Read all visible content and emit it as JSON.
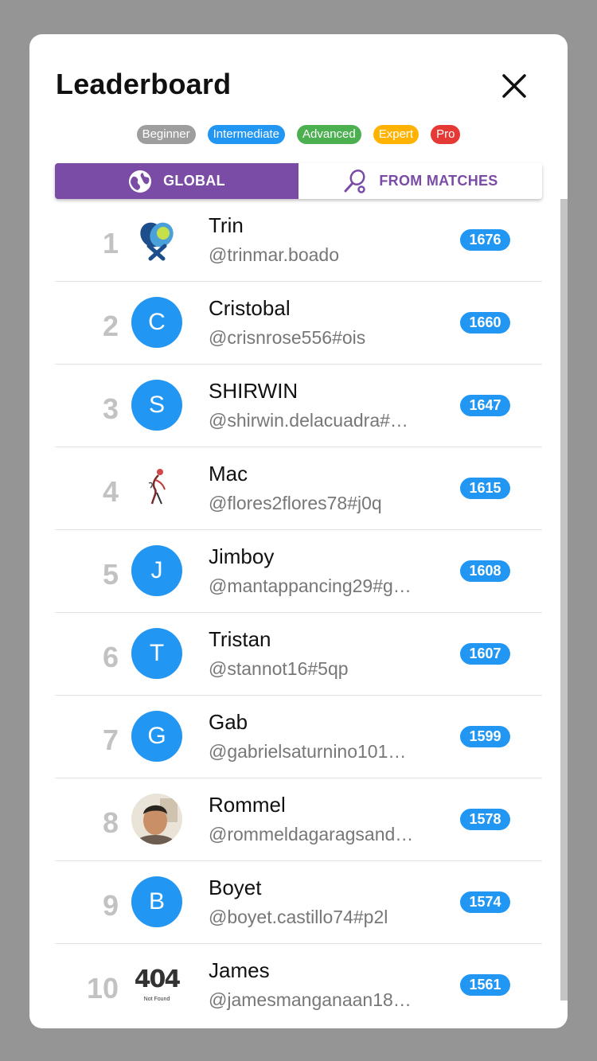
{
  "title": "Leaderboard",
  "close_icon": "close-icon",
  "levels": [
    {
      "label": "Beginner",
      "color": "#9e9e9e"
    },
    {
      "label": "Intermediate",
      "color": "#2196f3"
    },
    {
      "label": "Advanced",
      "color": "#4caf50"
    },
    {
      "label": "Expert",
      "color": "#ffb300"
    },
    {
      "label": "Pro",
      "color": "#e53935"
    }
  ],
  "tabs": [
    {
      "label": "GLOBAL",
      "icon": "globe-icon",
      "active": true
    },
    {
      "label": "FROM MATCHES",
      "icon": "paddle-icon",
      "active": false
    }
  ],
  "accent": "#7b4ca6",
  "players": [
    {
      "rank": "1",
      "name": "Trin",
      "handle": "@trinmar.boado",
      "rating": "1676",
      "avatar_type": "logo",
      "avatar_icon": "pickleball-logo-icon"
    },
    {
      "rank": "2",
      "name": "Cristobal",
      "handle": "@crisnrose556#ois",
      "rating": "1660",
      "avatar_type": "letter",
      "avatar_letter": "C"
    },
    {
      "rank": "3",
      "name": "SHIRWIN",
      "handle": "@shirwin.delacuadra#…",
      "rating": "1647",
      "avatar_type": "letter",
      "avatar_letter": "S"
    },
    {
      "rank": "4",
      "name": "Mac",
      "handle": "@flores2flores78#j0q",
      "rating": "1615",
      "avatar_type": "sketch",
      "avatar_icon": "player-sketch-icon"
    },
    {
      "rank": "5",
      "name": "Jimboy",
      "handle": "@mantappancing29#g…",
      "rating": "1608",
      "avatar_type": "letter",
      "avatar_letter": "J"
    },
    {
      "rank": "6",
      "name": "Tristan",
      "handle": "@stannot16#5qp",
      "rating": "1607",
      "avatar_type": "letter",
      "avatar_letter": "T"
    },
    {
      "rank": "7",
      "name": "Gab",
      "handle": "@gabrielsaturnino101…",
      "rating": "1599",
      "avatar_type": "letter",
      "avatar_letter": "G"
    },
    {
      "rank": "8",
      "name": "Rommel",
      "handle": "@rommeldagaragsand…",
      "rating": "1578",
      "avatar_type": "photo",
      "avatar_icon": "user-photo-icon"
    },
    {
      "rank": "9",
      "name": "Boyet",
      "handle": "@boyet.castillo74#p2l",
      "rating": "1574",
      "avatar_type": "letter",
      "avatar_letter": "B"
    },
    {
      "rank": "10",
      "name": "James",
      "handle": "@jamesmanganaan18…",
      "rating": "1561",
      "avatar_type": "notfound",
      "avatar_text": "404",
      "avatar_subtext": "Not Found"
    }
  ]
}
